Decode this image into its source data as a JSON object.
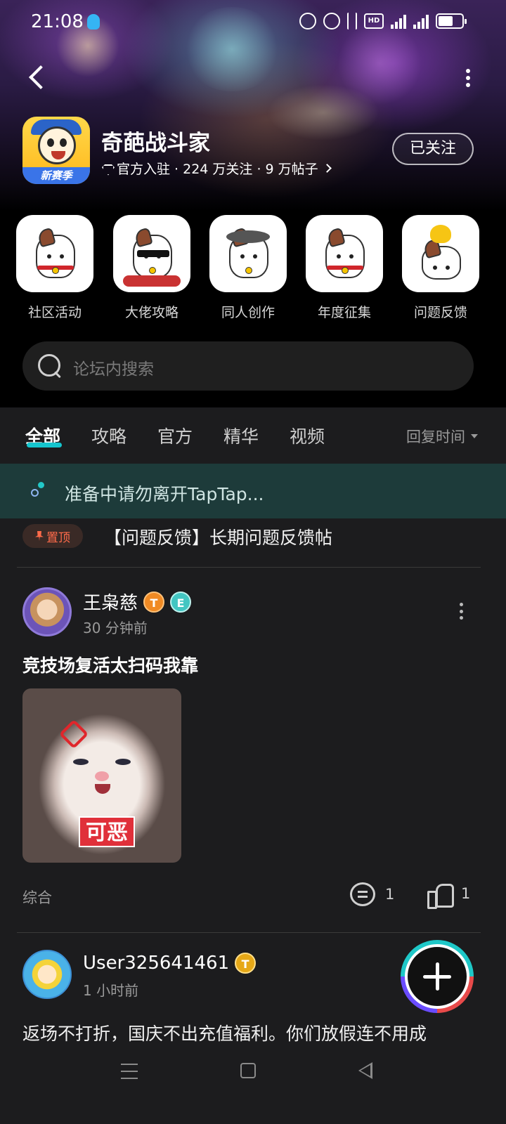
{
  "status_bar": {
    "time": "21:08",
    "icons": [
      "qq-icon",
      "alarm-icon",
      "mute-icon",
      "bluetooth-icon",
      "hd-icon",
      "signal-4g-icon",
      "signal-5g-icon",
      "battery-icon"
    ],
    "hd_label": "HD",
    "net1": "4G",
    "net2": "5G"
  },
  "header": {
    "game_name": "奇葩战斗家",
    "logo_tag": "新赛季",
    "meta": "官方入驻 · 224 万关注 · 9 万帖子",
    "follow_label": "已关注"
  },
  "quick_links": [
    {
      "label": "社区活动"
    },
    {
      "label": "大佬攻略"
    },
    {
      "label": "同人创作"
    },
    {
      "label": "年度征集"
    },
    {
      "label": "问题反馈"
    }
  ],
  "search": {
    "placeholder": "论坛内搜索"
  },
  "tabs": {
    "items": [
      "全部",
      "攻略",
      "官方",
      "精华",
      "视频"
    ],
    "active": "全部",
    "sort_label": "回复时间"
  },
  "notice": {
    "text": "准备中请勿离开TapTap..."
  },
  "pinned": {
    "badge": "置顶",
    "title": "【问题反馈】长期问题反馈帖"
  },
  "posts": [
    {
      "author": "王枭慈",
      "badges": [
        "T",
        "E"
      ],
      "time": "30 分钟前",
      "title": "竞技场复活太扫码我靠",
      "image_caption": "可恶",
      "category": "综合",
      "comments": "1",
      "likes": "1"
    },
    {
      "author": "User325641461",
      "badges": [
        "T"
      ],
      "time": "1 小时前",
      "body": "返场不打折，国庆不出充值福利。你们放假连不用成"
    }
  ],
  "colors": {
    "accent": "#15c5ce",
    "background": "#1c1c1e",
    "notice_bg": "#1d3b3a",
    "pin_red": "#ff6b4a"
  }
}
